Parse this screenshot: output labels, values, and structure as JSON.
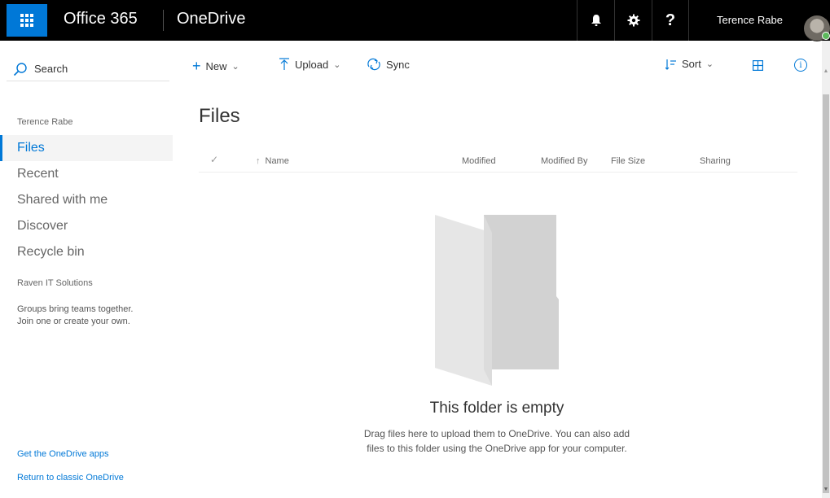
{
  "suitebar": {
    "brand": "Office 365",
    "app_name": "OneDrive",
    "help_label": "?",
    "user_name": "Terence Rabe"
  },
  "search": {
    "label": "Search"
  },
  "nav": {
    "owner": "Terence Rabe",
    "items": [
      {
        "label": "Files",
        "active": true
      },
      {
        "label": "Recent"
      },
      {
        "label": "Shared with me"
      },
      {
        "label": "Discover"
      },
      {
        "label": "Recycle bin"
      }
    ],
    "org": "Raven IT Solutions",
    "groups_line1": "Groups bring teams together.",
    "groups_line2": "Join one or create your own.",
    "get_apps": "Get the OneDrive apps",
    "return_classic": "Return to classic OneDrive"
  },
  "commandbar": {
    "new": "New",
    "upload": "Upload",
    "sync": "Sync",
    "sort": "Sort"
  },
  "main": {
    "title": "Files",
    "columns": {
      "name": "Name",
      "modified": "Modified",
      "modified_by": "Modified By",
      "file_size": "File Size",
      "sharing": "Sharing"
    },
    "empty_title": "This folder is empty",
    "empty_line1": "Drag files here to upload them to OneDrive. You can also add",
    "empty_line2": "files to this folder using the OneDrive app for your computer."
  },
  "colors": {
    "accent": "#0078d7",
    "suitebar": "#000000"
  }
}
